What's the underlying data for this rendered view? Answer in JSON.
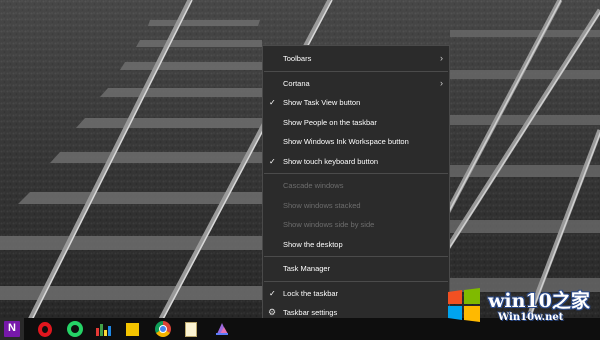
{
  "menu": {
    "items": [
      {
        "label": "Toolbars"
      },
      {
        "label": "Cortana"
      },
      {
        "label": "Show Task View button"
      },
      {
        "label": "Show People on the taskbar"
      },
      {
        "label": "Show Windows Ink Workspace button"
      },
      {
        "label": "Show touch keyboard button"
      },
      {
        "label": "Cascade windows"
      },
      {
        "label": "Show windows stacked"
      },
      {
        "label": "Show windows side by side"
      },
      {
        "label": "Show the desktop"
      },
      {
        "label": "Task Manager"
      },
      {
        "label": "Lock the taskbar"
      },
      {
        "label": "Taskbar settings"
      }
    ],
    "check_glyph": "✓",
    "arrow_glyph": "›",
    "gear_glyph": "⚙"
  },
  "taskbar": {
    "icons": [
      "onenote-icon",
      "opera-icon",
      "whatsapp-icon",
      "equalizer-icon",
      "sticky-notes-icon",
      "chrome-icon",
      "notepad-icon",
      "paint3d-icon"
    ]
  },
  "watermark": {
    "title": "win10之家",
    "url": "Win10w.net"
  },
  "colors": {
    "menu_bg": "#2b2b2b",
    "menu_text": "#ffffff",
    "menu_disabled": "#6d6d6d",
    "taskbar_bg": "#0e0e0e"
  }
}
